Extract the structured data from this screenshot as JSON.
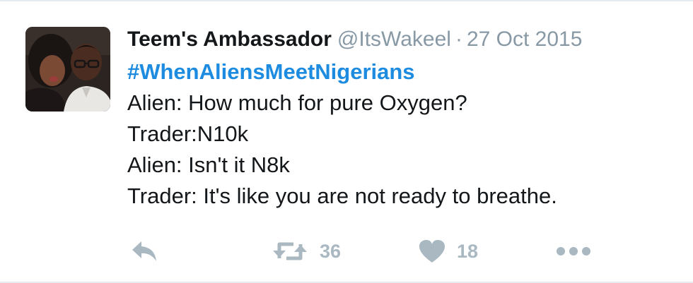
{
  "tweet": {
    "author": {
      "name": "Teem's Ambassador",
      "handle": "@ItsWakeel",
      "avatar_icon": "user-avatar-photo"
    },
    "separator": "·",
    "date": "27 Oct 2015",
    "hashtag": "#WhenAliensMeetNigerians",
    "lines": [
      "Alien: How much for pure Oxygen?",
      "Trader:N10k",
      "Alien: Isn't it N8k",
      "Trader: It's like you are not ready to breathe."
    ],
    "actions": {
      "reply_icon": "reply-icon",
      "retweet_icon": "retweet-icon",
      "retweet_count": "36",
      "like_icon": "heart-icon",
      "like_count": "18",
      "more_icon": "more-dots-icon"
    },
    "colors": {
      "text": "#14171a",
      "muted": "#8899a6",
      "link": "#1d8ce0",
      "action": "#aab8c2",
      "border": "#e6ecf0"
    }
  }
}
